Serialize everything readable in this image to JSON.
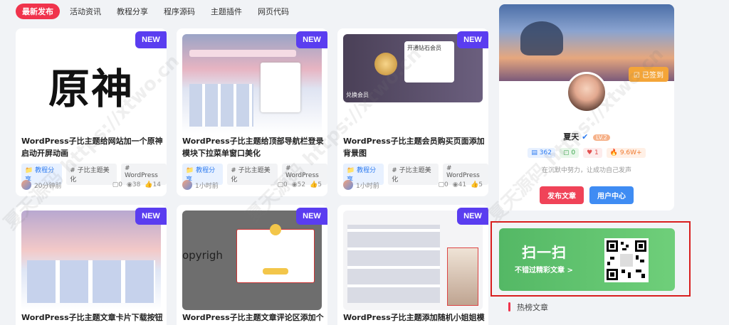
{
  "tabs": [
    "最新发布",
    "活动资讯",
    "教程分享",
    "程序源码",
    "主题插件",
    "网页代码"
  ],
  "new_label": "NEW",
  "cards": [
    {
      "title": "WordPress子比主题给网站加一个原神启动开屏动画",
      "thumb_text": "原神",
      "tags": [
        "教程分享",
        "子比主题美化",
        "WordPress"
      ],
      "time": "20分钟前",
      "comments": "0",
      "views": "38",
      "likes": "14"
    },
    {
      "title": "WordPress子比主题给顶部导航栏登录模块下拉菜单窗口美化",
      "tags": [
        "教程分享",
        "子比主题美化",
        "WordPress"
      ],
      "time": "1小时前",
      "comments": "0",
      "views": "52",
      "likes": "5"
    },
    {
      "title": "WordPress子比主题会员购买页面添加背景图",
      "thumb_text": "开通钻石会员",
      "thumb_sub": "兑换会员",
      "tags": [
        "教程分享",
        "子比主题美化",
        "WordPress"
      ],
      "time": "1小时前",
      "comments": "0",
      "views": "41",
      "likes": "5"
    },
    {
      "title": "WordPress子比主题文章卡片下载按钮"
    },
    {
      "title": "WordPress子比主题文章评论区添加个",
      "thumb_text": "opyrigh"
    },
    {
      "title": "WordPress子比主题添加随机小姐姐模"
    }
  ],
  "profile": {
    "signin": "已签到",
    "name": "夏天",
    "level": "LV.2",
    "stats": [
      "362",
      "0",
      "1",
      "9.6W+"
    ],
    "bio": "在沉默中努力，让成功自己发声",
    "publish_btn": "发布文章",
    "user_btn": "用户中心"
  },
  "qr": {
    "line1": "扫一扫",
    "line2": "不错过精彩文章 >"
  },
  "hot_title": "热榜文章",
  "watermark": "夏天源码 https://xtwo.cn",
  "colors": {
    "accent": "#f0334c",
    "new": "#5a3df0",
    "tag_primary": "#2d7bf0",
    "qr_green": "#54b865",
    "highlight_red": "#d81e1e"
  }
}
